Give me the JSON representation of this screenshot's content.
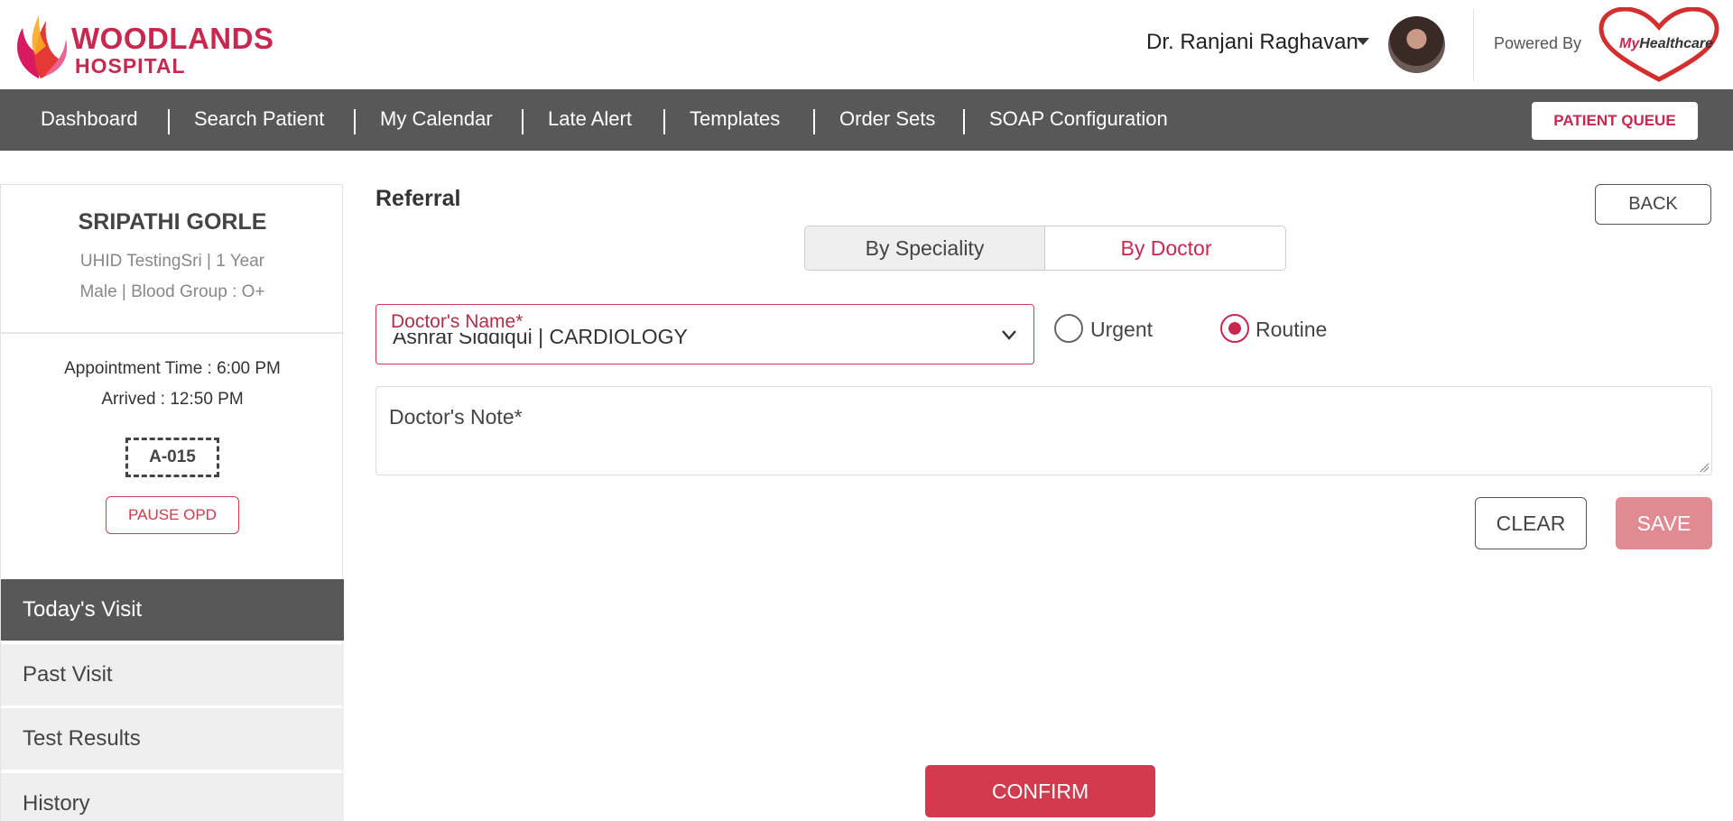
{
  "brand": {
    "line1": "WOODLANDS",
    "line2": "HOSPITAL",
    "accent": "#c8284f"
  },
  "header": {
    "user_name": "Dr. Ranjani Raghavan",
    "user_menu_icon": "caret-down-icon",
    "powered_by": "Powered By",
    "partner_logo_my": "My",
    "partner_logo_rest": "Healthcare"
  },
  "nav": {
    "items": [
      "Dashboard",
      "Search Patient",
      "My Calendar",
      "Late Alert",
      "Templates",
      "Order Sets",
      "SOAP Configuration"
    ],
    "queue_button": "PATIENT QUEUE"
  },
  "patient": {
    "name": "SRIPATHI GORLE",
    "uhid_line": "UHID TestingSri | 1 Year",
    "demographics_line": "Male | Blood Group : O+",
    "appointment_time": "Appointment Time : 6:00 PM",
    "arrived": "Arrived : 12:50 PM",
    "token": "A-015",
    "pause_button": "PAUSE OPD"
  },
  "sidebar": {
    "menu": [
      {
        "label": "Today's Visit",
        "active": true
      },
      {
        "label": "Past Visit",
        "active": false
      },
      {
        "label": "Test Results",
        "active": false
      },
      {
        "label": "History",
        "active": false
      }
    ]
  },
  "referral": {
    "title": "Referral",
    "back_button": "BACK",
    "toggle": {
      "by_speciality": "By Speciality",
      "by_doctor": "By Doctor",
      "selected": "By Doctor"
    },
    "doctor_field": {
      "label": "Doctor's Name*",
      "value": "Ashraf Siddiqui | CARDIOLOGY",
      "icon": "chevron-down-icon"
    },
    "priority": {
      "options": [
        "Urgent",
        "Routine"
      ],
      "selected": "Routine"
    },
    "note": {
      "placeholder": "Doctor's Note*",
      "value": ""
    },
    "clear_button": "CLEAR",
    "save_button": "SAVE",
    "confirm_button": "CONFIRM"
  }
}
